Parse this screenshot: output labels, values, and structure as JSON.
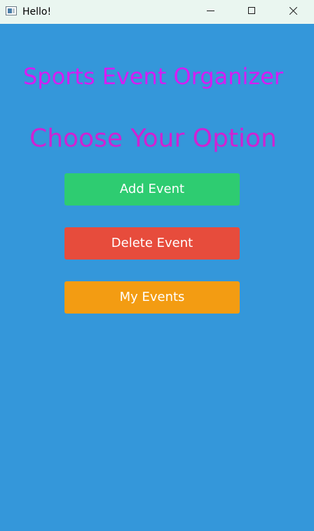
{
  "window": {
    "title": "Hello!",
    "controls": {
      "minimize_icon": "minimize-icon",
      "maximize_icon": "maximize-icon",
      "close_icon": "close-icon"
    }
  },
  "main": {
    "app_title": "Sports Event Organizer",
    "subtitle": "Choose Your Option",
    "buttons": [
      {
        "label": "Add Event",
        "color": "#2ecc71"
      },
      {
        "label": "Delete Event",
        "color": "#e74c3c"
      },
      {
        "label": "My Events",
        "color": "#f39c12"
      }
    ]
  },
  "colors": {
    "background": "#3497da",
    "title_color": "#d61cf3",
    "subtitle_color": "#cf22d3",
    "titlebar": "#eaf6f0"
  }
}
